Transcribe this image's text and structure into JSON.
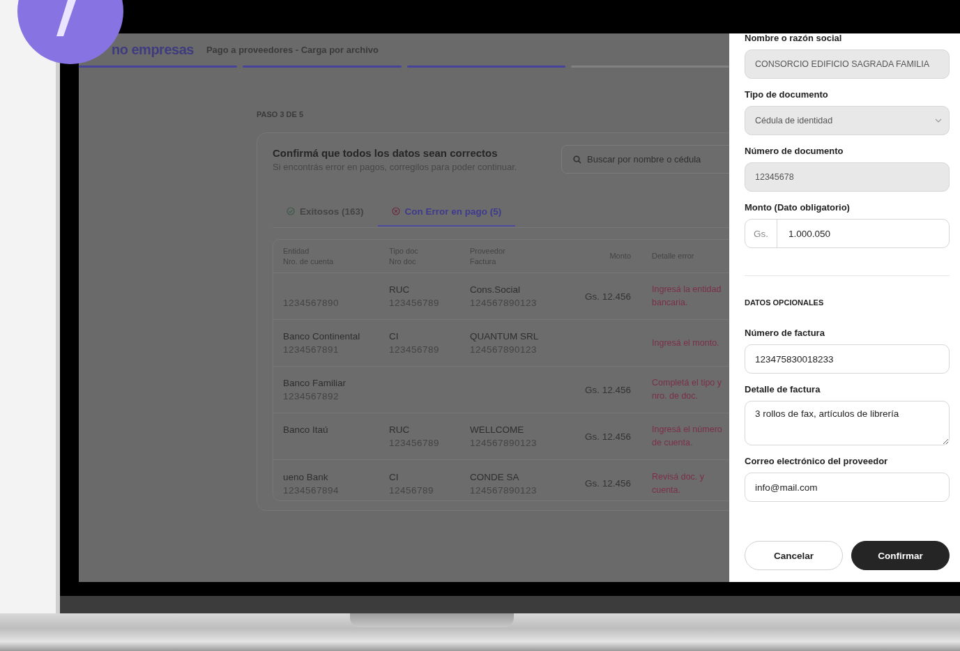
{
  "header": {
    "logo": "no empresas",
    "title": "Pago a proveedores - Carga por archivo"
  },
  "steps": [
    {
      "completed": true
    },
    {
      "completed": true
    },
    {
      "completed": true
    },
    {
      "completed": false
    }
  ],
  "step_label": "PASO 3 DE 5",
  "card": {
    "title": "Confirmá que todos los datos sean correctos",
    "subtitle": "Si encontrás error en pagos, corregilos para poder continuar.",
    "search": {
      "placeholder": "Buscar por nombre o cédula"
    }
  },
  "tabs": [
    {
      "kind": "success",
      "label": "Exitosos (163)",
      "selected": false
    },
    {
      "kind": "error",
      "label": "Con Error en pago (5)",
      "selected": true
    }
  ],
  "table": {
    "columns": [
      {
        "line1": "Entidad",
        "line2": "Nro. de cuenta"
      },
      {
        "line1": "Tipo doc",
        "line2": "Nro doc"
      },
      {
        "line1": "Proveedor",
        "line2": "Factura"
      },
      {
        "line1": "Monto"
      },
      {
        "line1": "Detalle error"
      }
    ],
    "rows": [
      {
        "account": "1234567890",
        "doc_type": "RUC",
        "doc_number": "123456789",
        "provider": "Cons.Social",
        "invoice": "124567890123",
        "amount": "Gs. 12.456",
        "error": "Ingresá la entidad bancaria."
      },
      {
        "entity": "Banco Continental",
        "account": "1234567891",
        "doc_type": "CI",
        "doc_number": "123456789",
        "provider": "QUANTUM SRL",
        "invoice": "124567890123",
        "error": "Ingresá el monto."
      },
      {
        "entity": "Banco Familiar",
        "account": "1234567892",
        "amount": "Gs. 12.456",
        "error": "Completá el tipo y nro. de doc."
      },
      {
        "entity": "Banco Itaú",
        "doc_type": "RUC",
        "doc_number": "123456789",
        "provider": "WELLCOME",
        "invoice": "124567890123",
        "amount": "Gs. 12.456",
        "error": "Ingresá el número de cuenta."
      },
      {
        "entity": "ueno Bank",
        "account": "1234567894",
        "doc_type": "CI",
        "doc_number": "12456789",
        "provider": "CONDE SA",
        "invoice": "124567890123",
        "amount": "Gs. 12.456",
        "error": "Revisá doc. y cuenta."
      }
    ]
  },
  "drawer": {
    "fields": [
      {
        "kind": "text",
        "label": "Nombre o razón social",
        "value": "CONSORCIO EDIFICIO SAGRADA FAMILIA",
        "disabled": true
      },
      {
        "kind": "select",
        "label": "Tipo de documento",
        "value": "Cédula de identidad",
        "disabled": true
      },
      {
        "kind": "text",
        "label": "Número de documento",
        "value": "12345678",
        "disabled": true
      },
      {
        "kind": "currency",
        "label": "**Monto** (Dato obligatorio)",
        "prefix": "Gs.",
        "value": "1.000.050",
        "disabled": false
      }
    ],
    "optional_title": "DATOS OPCIONALES",
    "optional_fields": [
      {
        "kind": "text",
        "label": "Número de factura",
        "value": "123475830018233",
        "disabled": false
      },
      {
        "kind": "textarea",
        "label": "Detalle de factura",
        "value": "3 rollos de fax, artículos de librería",
        "disabled": false
      },
      {
        "kind": "text",
        "label": "Correo electrónico del proveedor",
        "value": "info@mail.com",
        "disabled": false
      }
    ],
    "buttons": [
      {
        "kind": "secondary",
        "label": "Cancelar"
      },
      {
        "kind": "primary",
        "label": "Confirmar"
      }
    ]
  }
}
